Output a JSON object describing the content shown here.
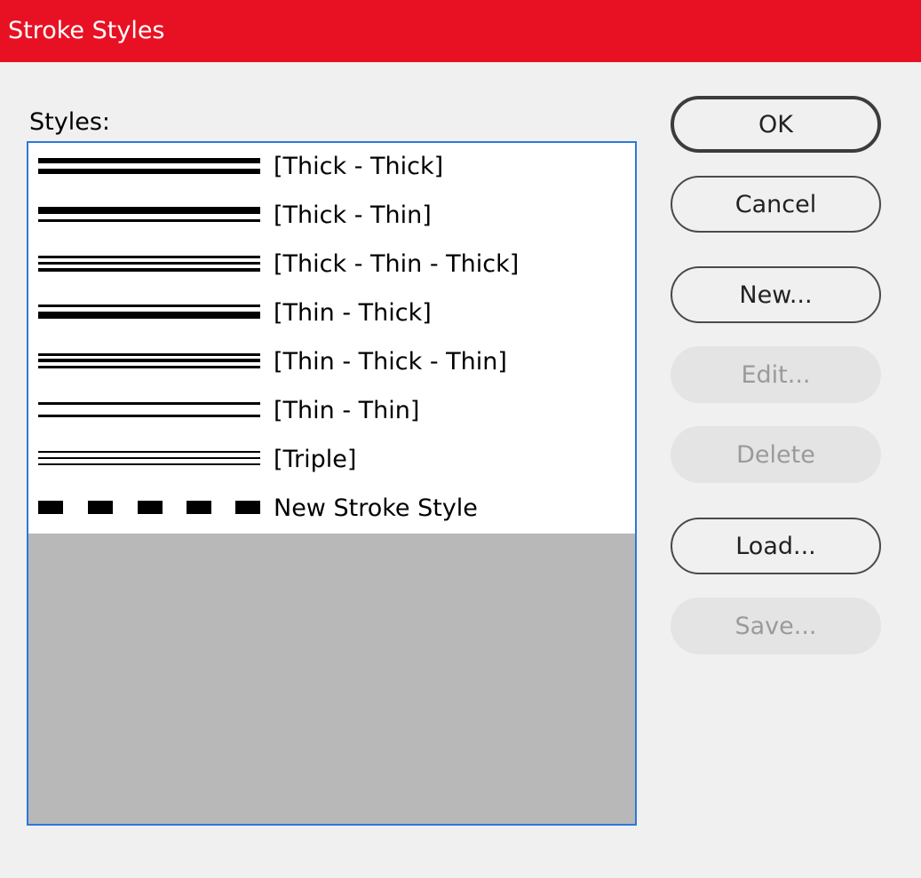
{
  "window": {
    "title": "Stroke Styles"
  },
  "styles_label": "Styles:",
  "list": {
    "items": [
      {
        "label": "[Thick - Thick]",
        "icon": "thick-thick-stroke-icon"
      },
      {
        "label": "[Thick - Thin]",
        "icon": "thick-thin-stroke-icon"
      },
      {
        "label": "[Thick - Thin - Thick]",
        "icon": "thick-thin-thick-stroke-icon"
      },
      {
        "label": "[Thin - Thick]",
        "icon": "thin-thick-stroke-icon"
      },
      {
        "label": "[Thin - Thick - Thin]",
        "icon": "thin-thick-thin-stroke-icon"
      },
      {
        "label": "[Thin - Thin]",
        "icon": "thin-thin-stroke-icon"
      },
      {
        "label": "[Triple]",
        "icon": "triple-stroke-icon"
      },
      {
        "label": "New Stroke Style",
        "icon": "dashed-stroke-icon"
      }
    ]
  },
  "buttons": {
    "ok": "OK",
    "cancel": "Cancel",
    "new": "New...",
    "edit": "Edit...",
    "delete": "Delete",
    "load": "Load...",
    "save": "Save..."
  },
  "colors": {
    "titlebar": "#e81123",
    "list_border": "#2b79d8",
    "list_empty_area": "#b8b8b8"
  }
}
